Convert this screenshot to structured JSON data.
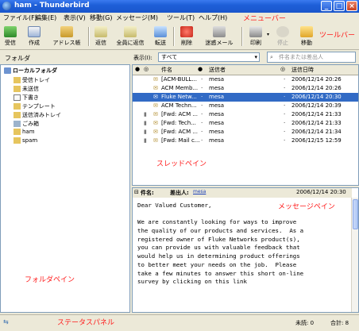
{
  "window": {
    "title": "ham - Thunderbird"
  },
  "menus": [
    "ファイル(F)",
    "編集(E)",
    "表示(V)",
    "移動(G)",
    "メッセージ(M)",
    "ツール(T)",
    "ヘルプ(H)"
  ],
  "annotations": {
    "menubar": "メニューバー",
    "toolbar": "ツールバー",
    "thread_pane": "スレッドペイン",
    "message_pane": "メッセージペイン",
    "folder_pane": "フォルダペイン",
    "status_panel": "ステータスパネル"
  },
  "toolbar": {
    "buttons": [
      {
        "label": "受信",
        "icon": "get-mail-icon"
      },
      {
        "label": "作成",
        "icon": "write-icon"
      },
      {
        "label": "アドレス帳",
        "icon": "address-book-icon"
      },
      {
        "label": "返信",
        "icon": "reply-icon"
      },
      {
        "label": "全員に返信",
        "icon": "reply-all-icon"
      },
      {
        "label": "転送",
        "icon": "forward-icon"
      },
      {
        "label": "削除",
        "icon": "delete-icon"
      },
      {
        "label": "迷惑メール",
        "icon": "junk-icon"
      },
      {
        "label": "印刷",
        "icon": "print-icon"
      },
      {
        "label": "停止",
        "icon": "stop-icon"
      },
      {
        "label": "移動",
        "icon": "move-icon"
      }
    ]
  },
  "folder_pane": {
    "header": "フォルダ",
    "root": "ローカルフォルダ",
    "folders": [
      "受信トレイ",
      "未送信",
      "下書き",
      "テンプレート",
      "送信済みトレイ",
      "ごみ箱",
      "ham",
      "spam"
    ]
  },
  "filter": {
    "view_label": "表示(I):",
    "view_value": "すべて",
    "search_placeholder": "件名または差出人"
  },
  "thread_pane": {
    "columns": {
      "subject": "件名",
      "from": "送信者",
      "date": "送信日時"
    },
    "rows": [
      {
        "subject": "[ACM-BULL...",
        "from": "mesa",
        "date": "2006/12/14 20:26",
        "attach": false,
        "selected": false
      },
      {
        "subject": "ACM Memb...",
        "from": "mesa",
        "date": "2006/12/14 20:26",
        "attach": false,
        "selected": false
      },
      {
        "subject": "Fluke Netw...",
        "from": "mesa",
        "date": "2006/12/14 20:30",
        "attach": false,
        "selected": true
      },
      {
        "subject": "ACM Techn...",
        "from": "mesa",
        "date": "2006/12/14 20:39",
        "attach": false,
        "selected": false
      },
      {
        "subject": "[Fwd: ACM ...",
        "from": "mesa",
        "date": "2006/12/14 21:33",
        "attach": true,
        "selected": false
      },
      {
        "subject": "[Fwd: Tech...",
        "from": "mesa",
        "date": "2006/12/14 21:33",
        "attach": true,
        "selected": false
      },
      {
        "subject": "[Fwd: ACM ...",
        "from": "mesa",
        "date": "2006/12/14 21:34",
        "attach": true,
        "selected": false
      },
      {
        "subject": "[Fwd: Mail c...",
        "from": "mesa",
        "date": "2006/12/15 12:59",
        "attach": true,
        "selected": false
      }
    ]
  },
  "message_pane": {
    "subject_label": "件名:",
    "from_label": "差出人:",
    "from_value": "mesa",
    "date": "2006/12/14 20:30",
    "body_lines": [
      "Dear Valued Customer,",
      "",
      "We are constantly looking for ways to improve",
      "the quality of our products and services.  As a",
      "registered owner of Fluke Networks product(s),",
      "you can provide us with valuable feedback that",
      "would help us in determining product offerings",
      "to better meet your needs on the job.  Please",
      "take a few minutes to answer this short on-line",
      "survey by clicking on this link"
    ]
  },
  "status": {
    "unread": "未読: 0",
    "total": "合計: 8"
  }
}
